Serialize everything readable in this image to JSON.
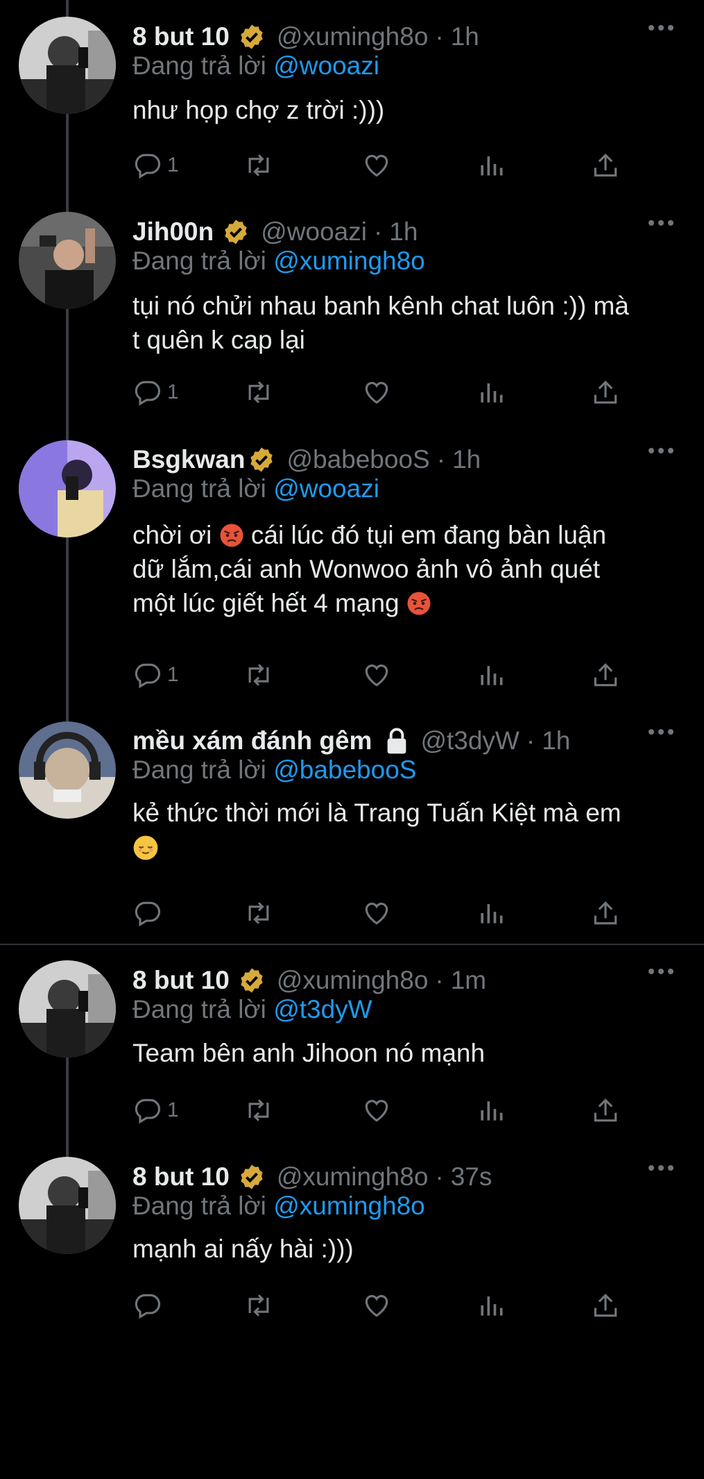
{
  "reply_prefix": "Đang trả lời",
  "tweets": [
    {
      "name": "8 but 10",
      "handle": "@xumingh8o",
      "time": "1h",
      "reply_to": "@wooazi",
      "text": "như họp chợ z trời :)))",
      "reply_count": "1"
    },
    {
      "name": "Jih00n",
      "handle": "@wooazi",
      "time": "1h",
      "reply_to": "@xumingh8o",
      "text_line1": "tụi nó chửi nhau banh kênh chat luôn :)) mà",
      "text_line2": "t quên k cap lại",
      "reply_count": "1"
    },
    {
      "name": "Bsgkwan",
      "handle": "@babebooS",
      "time": "1h",
      "reply_to": "@wooazi",
      "text_a": "chời ơi",
      "text_b": "cái lúc đó tụi em đang bàn luận",
      "text_line2": "dữ lắm,cái anh Wonwoo ảnh vô ảnh quét",
      "text_line3": "một lúc giết hết 4 mạng",
      "reply_count": "1"
    },
    {
      "name": "mều xám đánh gêm",
      "handle": "@t3dyW",
      "time": "1h",
      "reply_to": "@babebooS",
      "text_line1": "kẻ thức thời mới là Trang Tuấn Kiệt mà em",
      "reply_count": ""
    },
    {
      "name": "8 but 10",
      "handle": "@xumingh8o",
      "time": "1m",
      "reply_to": "@t3dyW",
      "text": "Team bên anh Jihoon nó mạnh",
      "reply_count": "1"
    },
    {
      "name": "8 but 10",
      "handle": "@xumingh8o",
      "time": "37s",
      "reply_to": "@xumingh8o",
      "text": "mạnh ai nấy hài :)))",
      "reply_count": ""
    }
  ],
  "icons": {
    "verified_color": "#d6a93b",
    "icon_color": "#71767b",
    "mention_color": "#1d9bf0"
  }
}
